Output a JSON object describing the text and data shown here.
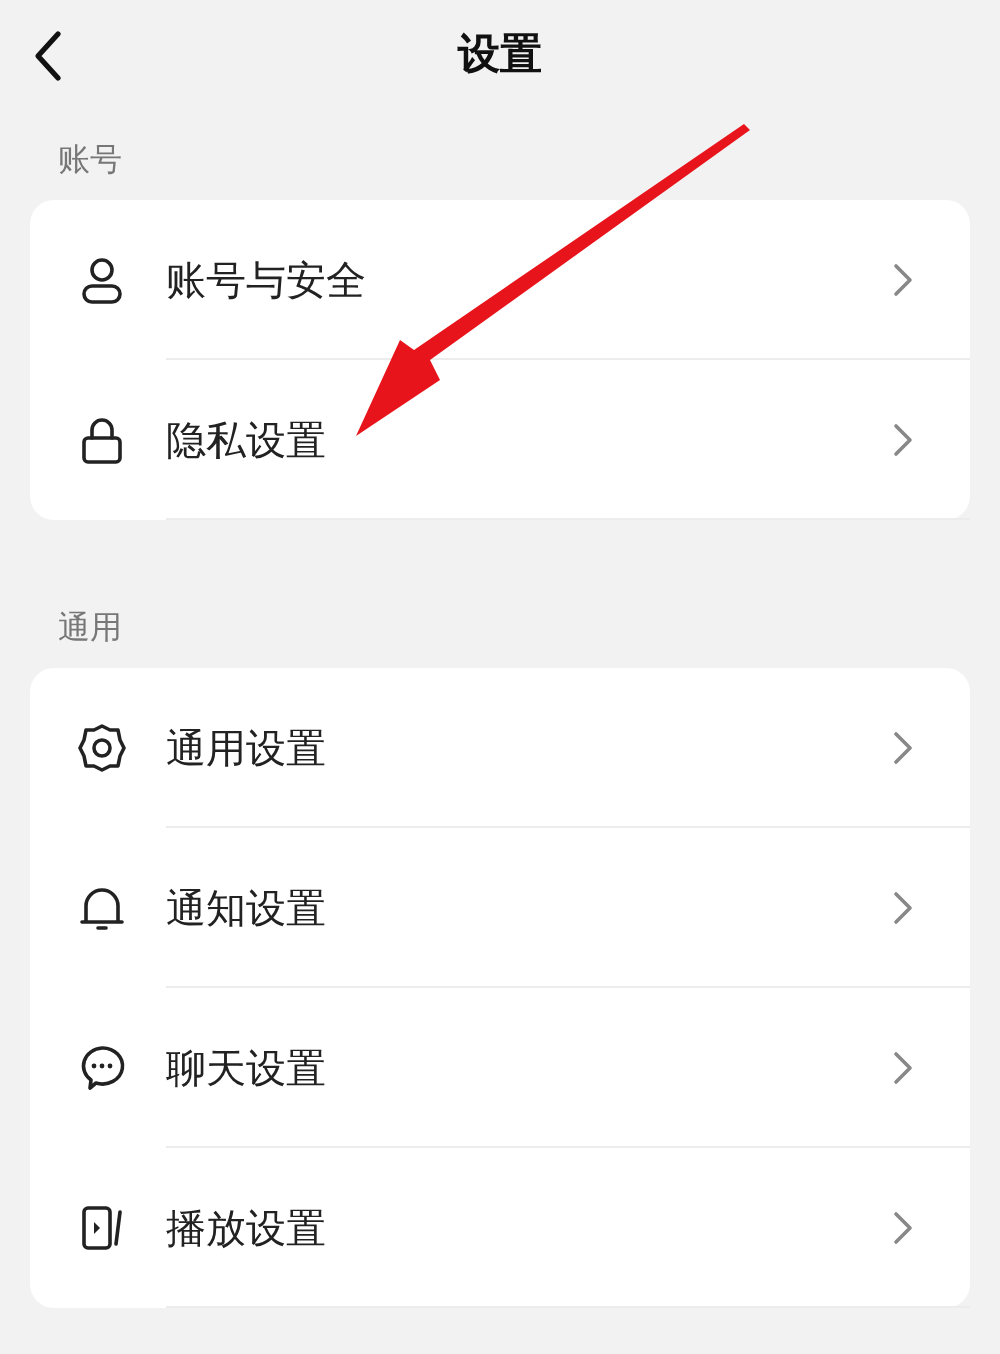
{
  "header": {
    "title": "设置"
  },
  "sections": [
    {
      "title": "账号",
      "items": [
        {
          "label": "账号与安全",
          "kind": "person"
        },
        {
          "label": "隐私设置",
          "kind": "lock"
        }
      ]
    },
    {
      "title": "通用",
      "items": [
        {
          "label": "通用设置",
          "kind": "gear"
        },
        {
          "label": "通知设置",
          "kind": "bell"
        },
        {
          "label": "聊天设置",
          "kind": "chat"
        },
        {
          "label": "播放设置",
          "kind": "player"
        }
      ]
    }
  ],
  "annotation": {
    "kind": "arrow"
  }
}
